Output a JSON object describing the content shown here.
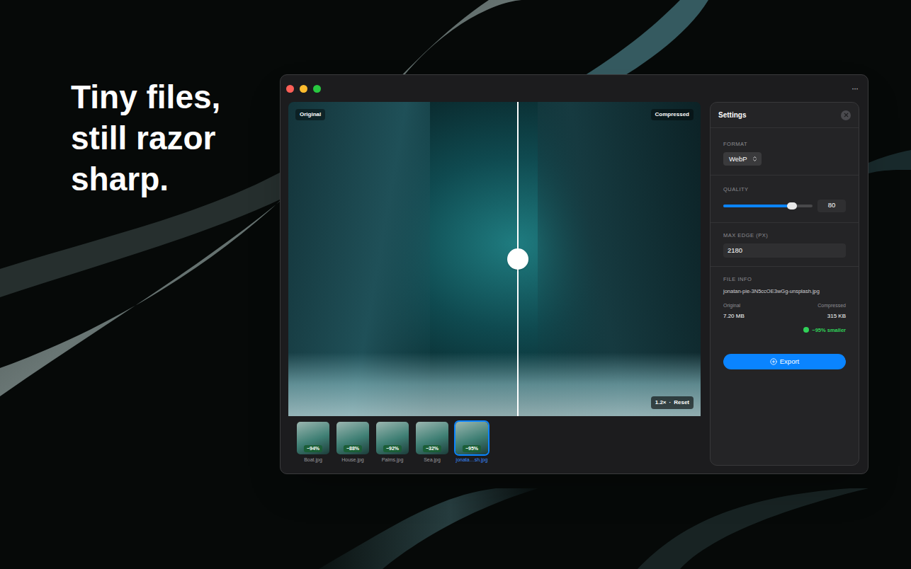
{
  "headline": [
    "Tiny files,",
    "still razor",
    "sharp."
  ],
  "window": {
    "menu_icon": "···"
  },
  "preview": {
    "left_label": "Original",
    "right_label": "Compressed",
    "split": 0.557,
    "zoom": "1.2×",
    "separator": "·",
    "reset": "Reset"
  },
  "thumbnails": [
    {
      "name": "Boat.jpg",
      "badge": "−94%",
      "selected": false
    },
    {
      "name": "House.jpg",
      "badge": "−88%",
      "selected": false
    },
    {
      "name": "Palms.jpg",
      "badge": "−92%",
      "selected": false
    },
    {
      "name": "Sea.jpg",
      "badge": "−32%",
      "selected": false
    },
    {
      "name": "jonata…sh.jpg",
      "badge": "−95%",
      "selected": true
    }
  ],
  "settings": {
    "title": "Settings",
    "format": {
      "label": "FORMAT",
      "value": "WebP"
    },
    "quality": {
      "label": "QUALITY",
      "level": 0.77,
      "value": "80"
    },
    "max_edge": {
      "label": "MAX EDGE (PX)",
      "value": "2180"
    },
    "file_info": {
      "label": "FILE INFO",
      "filename": "jonatan-pie-3N5ccOE3wGg-unsplash.jpg",
      "original_label": "Original",
      "original_size": "7.20 MB",
      "compressed_label": "Compressed",
      "compressed_size": "315 KB",
      "savings": "−95% smaller"
    },
    "export": "Export"
  }
}
